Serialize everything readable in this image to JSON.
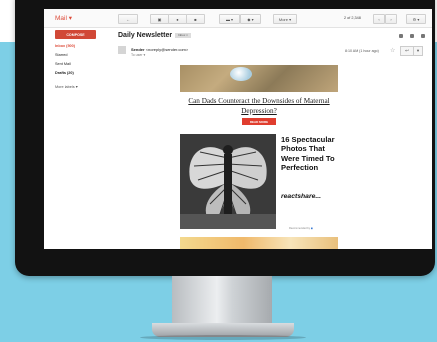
{
  "app": {
    "title": "Mail"
  },
  "toolbar": {
    "more_label": "More",
    "page_count": "2 of 2,348"
  },
  "sidebar": {
    "compose_label": "COMPOSE",
    "items": [
      {
        "label": "Inbox (500)"
      },
      {
        "label": "Starred"
      },
      {
        "label": "Sent Mail"
      },
      {
        "label": "Drafts (20)"
      },
      {
        "label": "More labels"
      }
    ]
  },
  "message": {
    "subject": "Daily Newsletter",
    "label_chip": "Inbox",
    "sender_name": "Sender",
    "sender_email": "<noreply@sender.com>",
    "to": "To user",
    "time": "8:10 AM (1 hour ago)"
  },
  "email": {
    "article_title": "Can Dads Counteract the Downsides of Maternal Depression?",
    "read_more": "READ MORE",
    "promo_text": "16 Spectacular Photos That Were Timed To Perfection",
    "promo_brand": "reactshare...",
    "powered_by": "Recommended by"
  },
  "colors": {
    "accent": "#dd4b39",
    "compose": "#d14836",
    "read_more": "#e03d2e",
    "background_teal": "#7dcfe6"
  }
}
